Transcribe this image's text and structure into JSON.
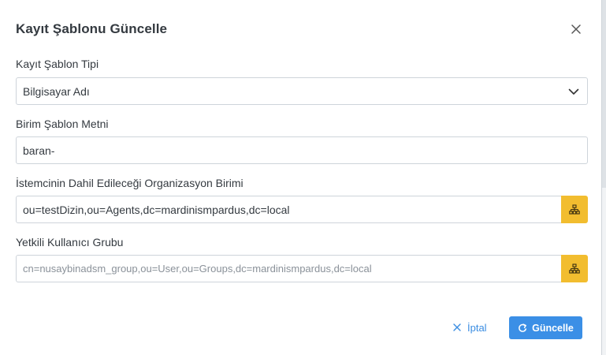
{
  "dialog": {
    "title": "Kayıt Şablonu Güncelle"
  },
  "fields": {
    "template_type": {
      "label": "Kayıt Şablon Tipi",
      "value": "Bilgisayar Adı"
    },
    "unit_template_text": {
      "label": "Birim Şablon Metni",
      "value": "baran-"
    },
    "organization_unit": {
      "label": "İstemcinin Dahil Edileceği Organizasyon Birimi",
      "value": "ou=testDizin,ou=Agents,dc=mardinismpardus,dc=local"
    },
    "authorized_group": {
      "label": "Yetkili Kullanıcı Grubu",
      "value": "cn=nusaybinadsm_group,ou=User,ou=Groups,dc=mardinismpardus,dc=local"
    }
  },
  "footer": {
    "cancel_label": "İptal",
    "update_label": "Güncelle"
  },
  "colors": {
    "primary": "#3b8fe6",
    "addon": "#f2bd2f",
    "border": "#ced4da",
    "text": "#343a40"
  },
  "icons": {
    "close": "close-icon",
    "select": "chevron-down-icon",
    "org_tree": "sitemap-icon",
    "cancel": "x-icon",
    "update": "refresh-icon"
  }
}
